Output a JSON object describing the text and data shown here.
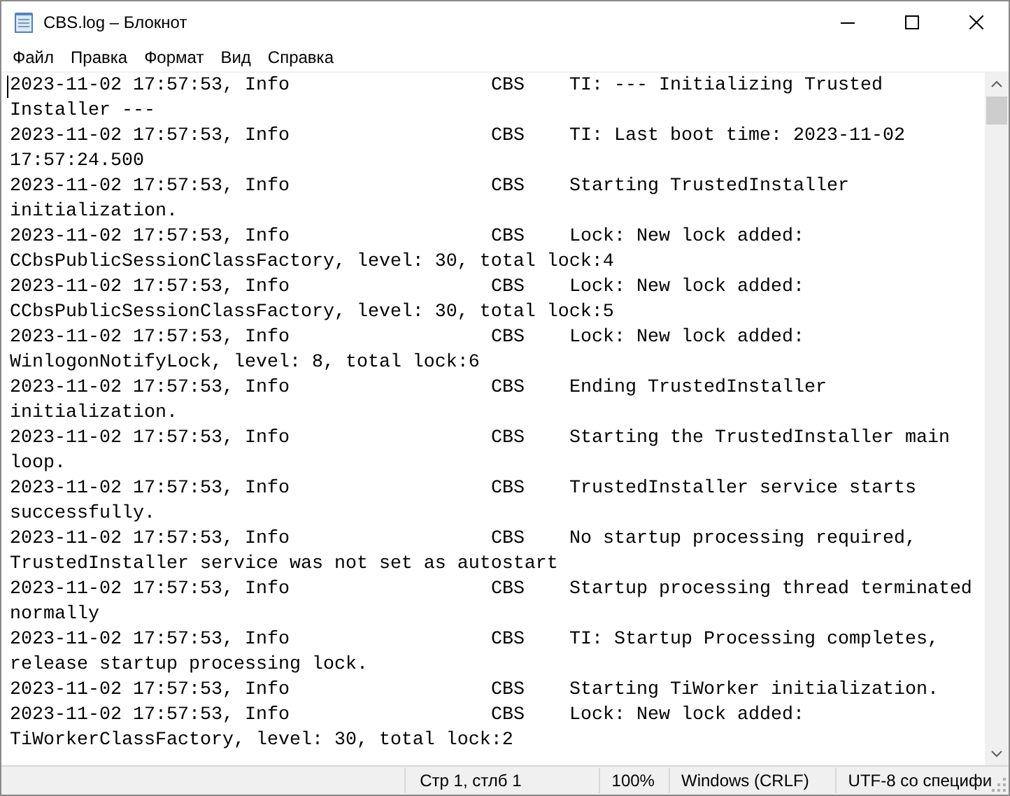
{
  "window": {
    "title": "CBS.log – Блокнот"
  },
  "menu": [
    "Файл",
    "Правка",
    "Формат",
    "Вид",
    "Справка"
  ],
  "log": [
    {
      "timestamp": "2023-11-02 17:57:53, Info",
      "source": "CBS",
      "message": "TI: --- Initializing Trusted Installer ---"
    },
    {
      "timestamp": "2023-11-02 17:57:53, Info",
      "source": "CBS",
      "message": "TI: Last boot time: 2023-11-02 17:57:24.500"
    },
    {
      "timestamp": "2023-11-02 17:57:53, Info",
      "source": "CBS",
      "message": "Starting TrustedInstaller initialization."
    },
    {
      "timestamp": "2023-11-02 17:57:53, Info",
      "source": "CBS",
      "message": "Lock: New lock added: CCbsPublicSessionClassFactory, level: 30, total lock:4"
    },
    {
      "timestamp": "2023-11-02 17:57:53, Info",
      "source": "CBS",
      "message": "Lock: New lock added: CCbsPublicSessionClassFactory, level: 30, total lock:5"
    },
    {
      "timestamp": "2023-11-02 17:57:53, Info",
      "source": "CBS",
      "message": "Lock: New lock added: WinlogonNotifyLock, level: 8, total lock:6"
    },
    {
      "timestamp": "2023-11-02 17:57:53, Info",
      "source": "CBS",
      "message": "Ending TrustedInstaller initialization."
    },
    {
      "timestamp": "2023-11-02 17:57:53, Info",
      "source": "CBS",
      "message": "Starting the TrustedInstaller main loop."
    },
    {
      "timestamp": "2023-11-02 17:57:53, Info",
      "source": "CBS",
      "message": "TrustedInstaller service starts successfully."
    },
    {
      "timestamp": "2023-11-02 17:57:53, Info",
      "source": "CBS",
      "message": "No startup processing required, TrustedInstaller service was not set as autostart"
    },
    {
      "timestamp": "2023-11-02 17:57:53, Info",
      "source": "CBS",
      "message": "Startup processing thread terminated normally"
    },
    {
      "timestamp": "2023-11-02 17:57:53, Info",
      "source": "CBS",
      "message": "TI: Startup Processing completes, release startup processing lock."
    },
    {
      "timestamp": "2023-11-02 17:57:53, Info",
      "source": "CBS",
      "message": "Starting TiWorker initialization."
    },
    {
      "timestamp": "2023-11-02 17:57:53, Info",
      "source": "CBS",
      "message": "Lock: New lock added: TiWorkerClassFactory, level: 30, total lock:2"
    }
  ],
  "status_bar": {
    "position": "Стр 1, стлб 1",
    "zoom": "100%",
    "line_endings": "Windows (CRLF)",
    "encoding": "UTF-8 со специфи"
  }
}
